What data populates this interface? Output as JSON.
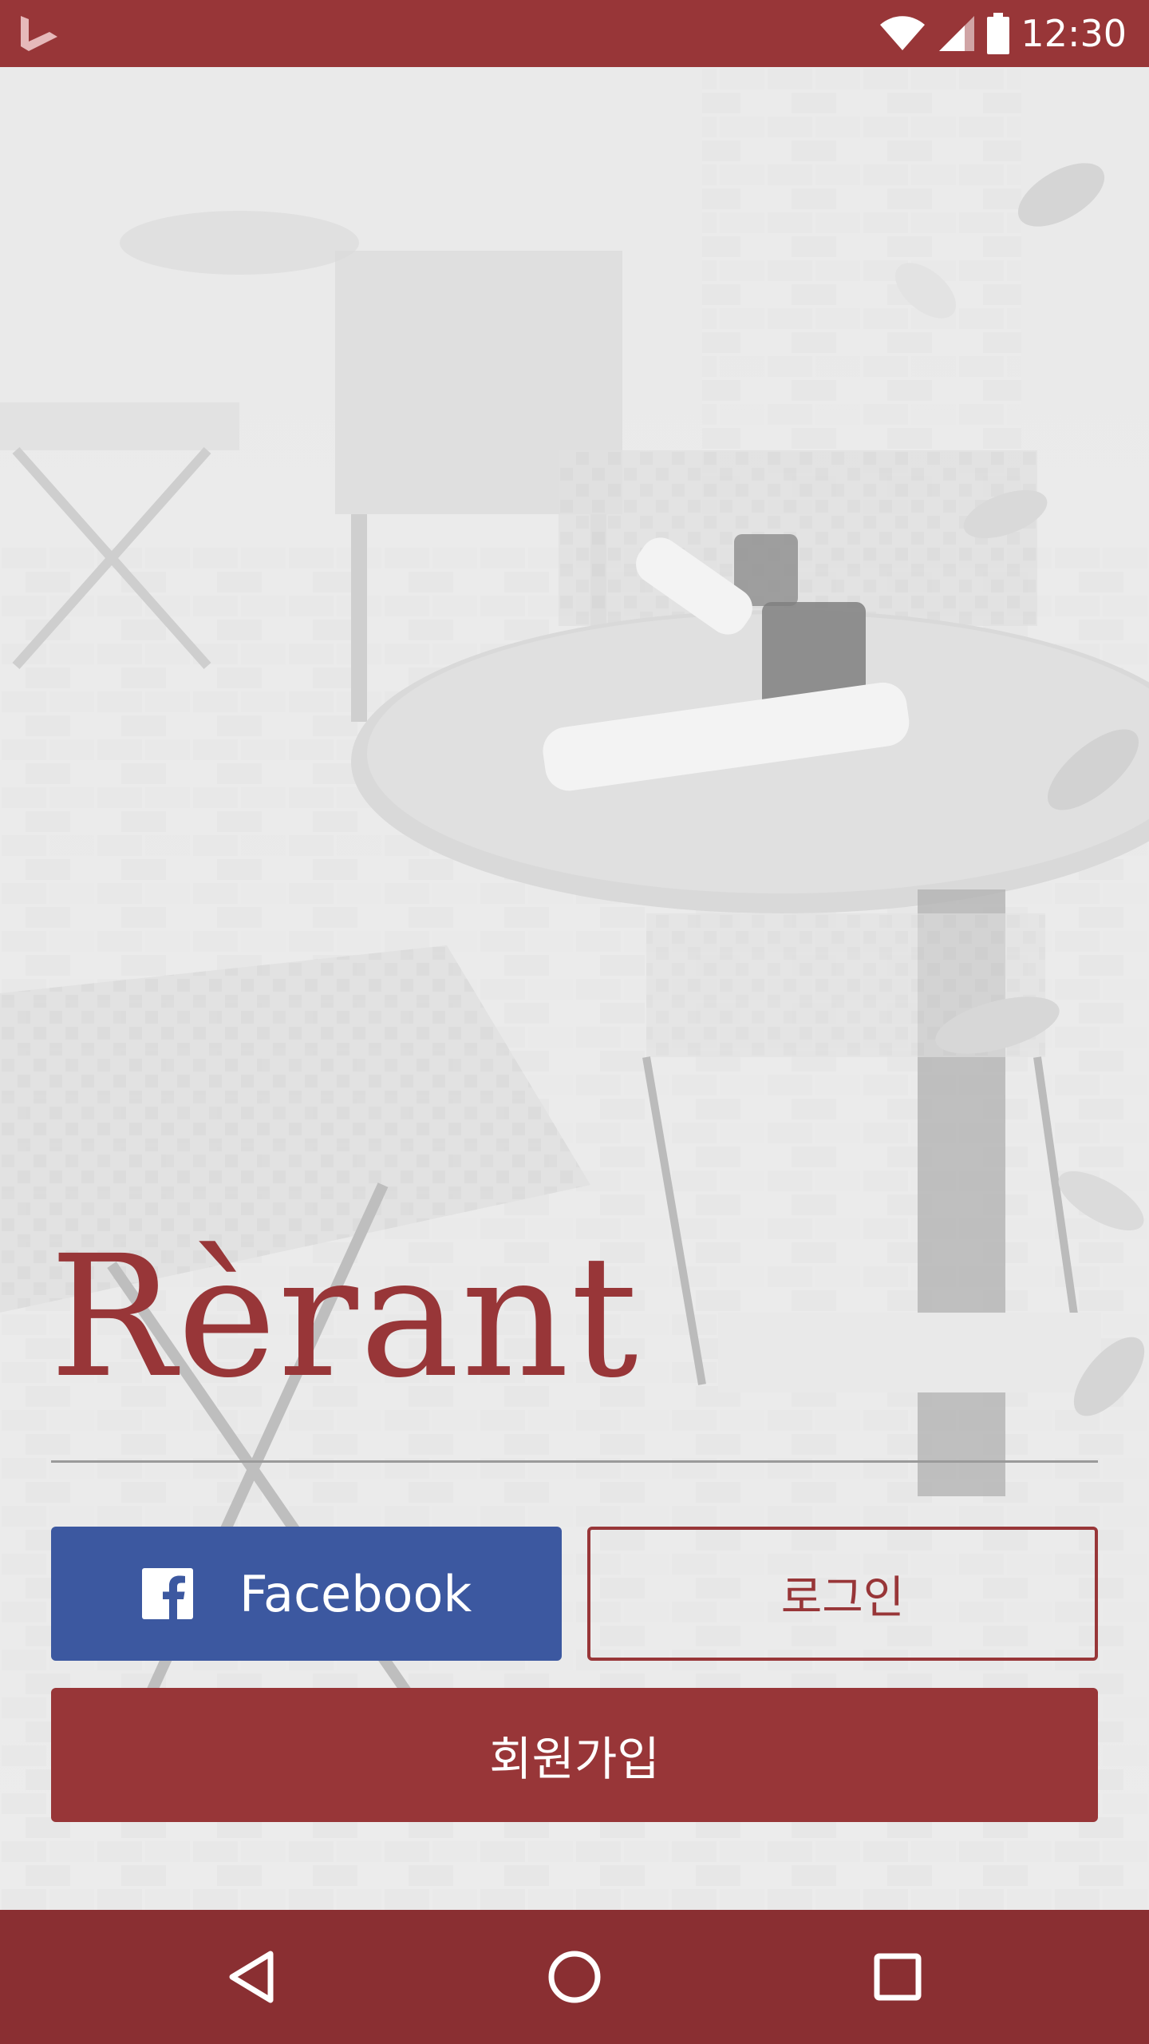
{
  "status_bar": {
    "time": "12:30",
    "icons": [
      "bing-app-icon",
      "wifi-icon",
      "cell-signal-icon",
      "battery-icon"
    ]
  },
  "brand": {
    "logo": "Rèrant"
  },
  "buttons": {
    "facebook_label": "Facebook",
    "facebook_icon": "facebook-icon",
    "login_label": "로그인",
    "signup_label": "회원가입"
  },
  "nav_bar": {
    "icons": [
      "back-icon",
      "home-icon",
      "recents-icon"
    ]
  },
  "colors": {
    "brand": "#983638",
    "nav_bar": "#8a2f32",
    "facebook": "#3c58a0",
    "divider": "#9a9a9a"
  }
}
